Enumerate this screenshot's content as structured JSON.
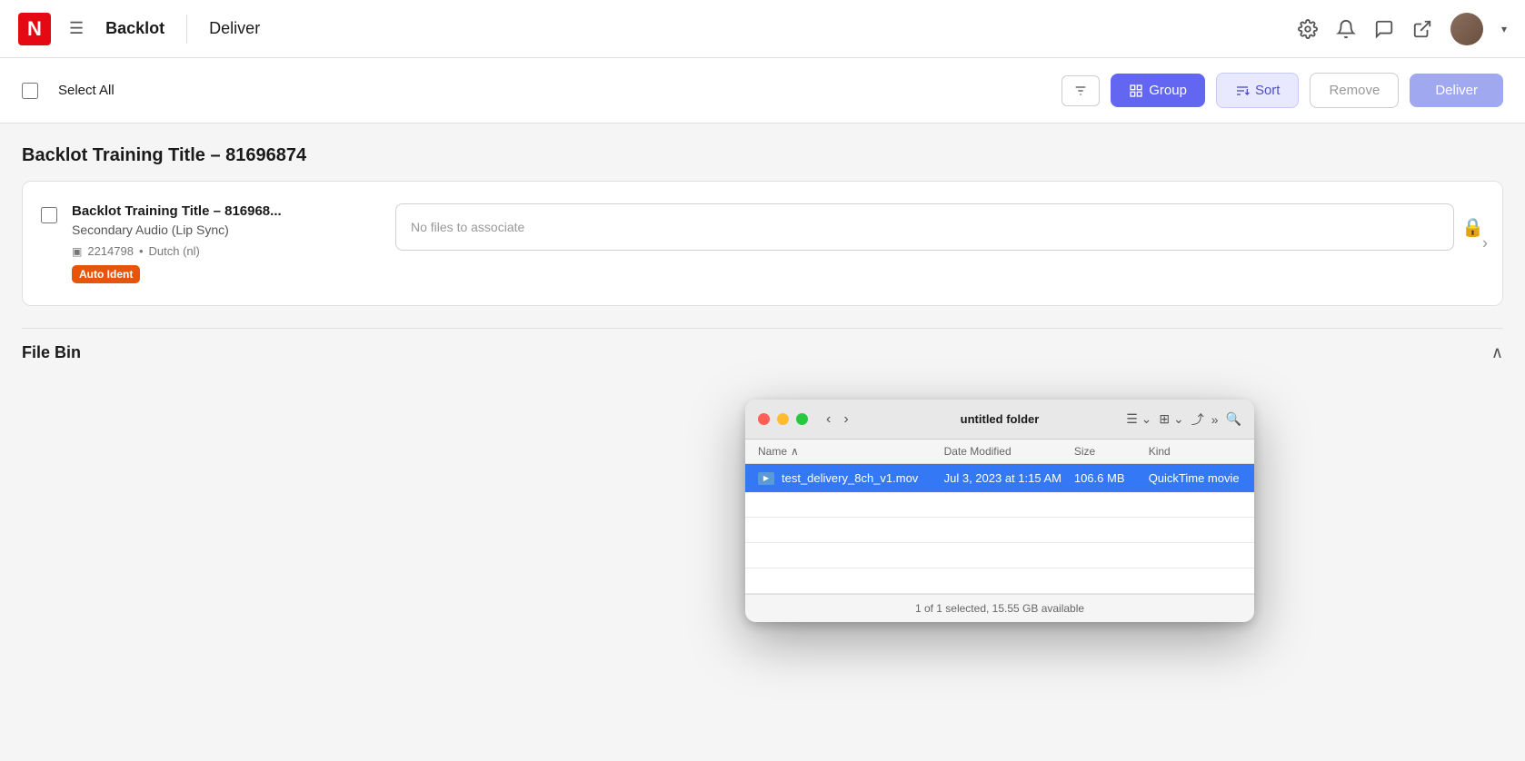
{
  "nav": {
    "logo_letter": "N",
    "app_title": "Backlot",
    "page_title": "Deliver"
  },
  "toolbar": {
    "select_all_label": "Select All",
    "group_label": "Group",
    "sort_label": "Sort",
    "remove_label": "Remove",
    "deliver_label": "Deliver"
  },
  "section": {
    "title": "Backlot Training Title – 81696874"
  },
  "card": {
    "main_title": "Backlot Training Title – 816968...",
    "subtitle": "Secondary Audio (Lip Sync)",
    "meta_id": "2214798",
    "meta_lang": "Dutch (nl)",
    "badge": "Auto Ident",
    "file_placeholder": "No files to associate"
  },
  "finder": {
    "title": "untitled folder",
    "columns": {
      "name": "Name",
      "date_modified": "Date Modified",
      "size": "Size",
      "kind": "Kind"
    },
    "file": {
      "name": "test_delivery_8ch_v1.mov",
      "date_modified": "Jul 3, 2023 at 1:15 AM",
      "size": "106.6 MB",
      "kind": "QuickTime movie"
    },
    "status": "1 of 1 selected, 15.55 GB available"
  },
  "file_bin": {
    "title": "File Bin"
  }
}
